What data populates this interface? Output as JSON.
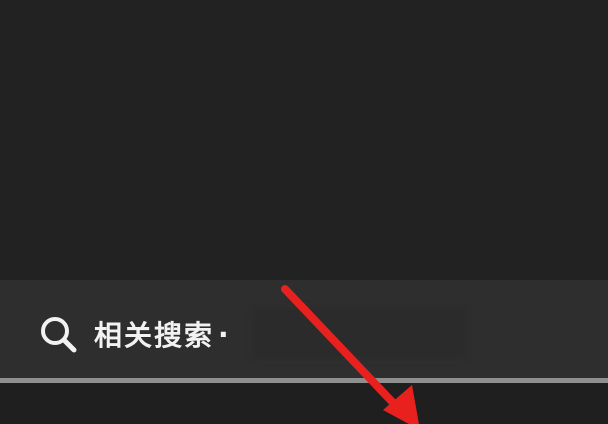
{
  "related_search": {
    "icon": "search-icon",
    "label": "相关搜索",
    "separator": "·"
  },
  "annotation": {
    "icon": "red-arrow-icon",
    "color": "#e8211f"
  },
  "colors": {
    "background": "#222222",
    "search_bar": "#2e2e2e",
    "divider": "#8f8f8f",
    "text": "#f2f2f2"
  }
}
